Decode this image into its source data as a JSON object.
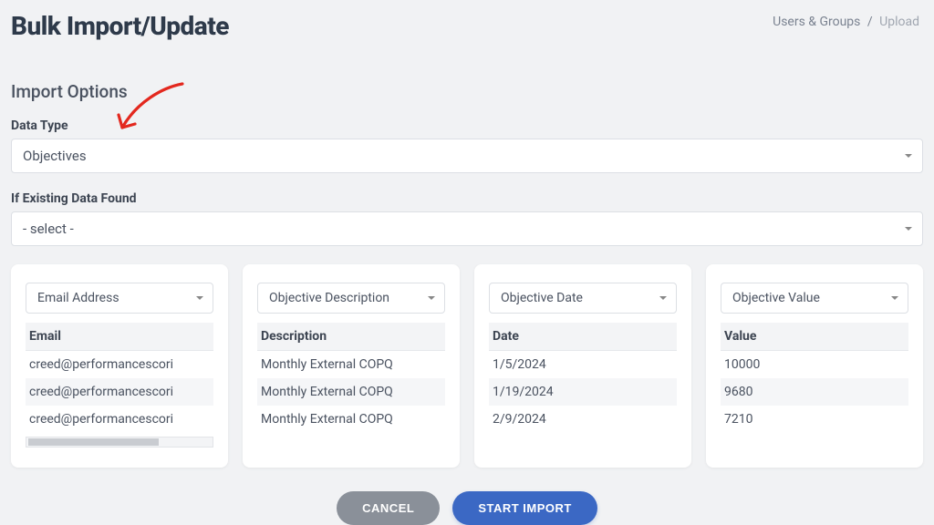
{
  "header": {
    "title": "Bulk Import/Update",
    "breadcrumb": {
      "parent": "Users & Groups",
      "current": "Upload",
      "separator": "/"
    }
  },
  "options": {
    "section_title": "Import Options",
    "data_type_label": "Data Type",
    "data_type_value": "Objectives",
    "existing_label": "If Existing Data Found",
    "existing_value": "- select -"
  },
  "columns": [
    {
      "mapping_label": "Email Address",
      "header": "Email",
      "rows": [
        "creed@performancescori",
        "creed@performancescori",
        "creed@performancescori"
      ],
      "has_scroll": true
    },
    {
      "mapping_label": "Objective Description",
      "header": "Description",
      "rows": [
        "Monthly External COPQ",
        "Monthly External COPQ",
        "Monthly External COPQ"
      ],
      "has_scroll": false
    },
    {
      "mapping_label": "Objective Date",
      "header": "Date",
      "rows": [
        "1/5/2024",
        "1/19/2024",
        "2/9/2024"
      ],
      "has_scroll": false
    },
    {
      "mapping_label": "Objective Value",
      "header": "Value",
      "rows": [
        "10000",
        "9680",
        "7210"
      ],
      "has_scroll": false
    }
  ],
  "actions": {
    "cancel": "CANCEL",
    "start": "START IMPORT"
  },
  "colors": {
    "primary": "#3b68c4",
    "cancel": "#8a9099",
    "annotation": "#e3281e"
  }
}
